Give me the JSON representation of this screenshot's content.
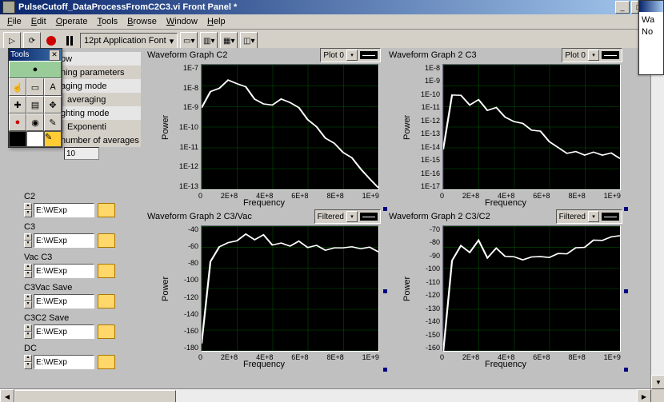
{
  "window": {
    "title": "PulseCutoff_DataProcessFromC2C3.vi Front Panel *"
  },
  "menu": {
    "items": [
      "File",
      "Edit",
      "Operate",
      "Tools",
      "Browse",
      "Window",
      "Help"
    ]
  },
  "toolbar": {
    "font_label": "12pt Application Font"
  },
  "tools_palette": {
    "title": "Tools"
  },
  "settings": {
    "items": [
      "ow",
      "ning parameters",
      "aging mode",
      "averaging",
      "ghting mode",
      "Exponenti",
      "number of averages"
    ],
    "num_avg_value": "10"
  },
  "paths": [
    {
      "label": "C2",
      "value": "E:\\WExp"
    },
    {
      "label": "C3",
      "value": "E:\\WExp"
    },
    {
      "label": "Vac C3",
      "value": "E:\\WExp"
    },
    {
      "label": "C3Vac Save",
      "value": "E:\\WExp"
    },
    {
      "label": "C3C2 Save",
      "value": "E:\\WExp"
    },
    {
      "label": "DC",
      "value": "E:\\WExp"
    }
  ],
  "axes": {
    "xlabel": "Frequency",
    "ylabel": "Power",
    "xticks": [
      "0",
      "2E+8",
      "4E+8",
      "6E+8",
      "8E+8",
      "1E+9"
    ]
  },
  "graphs": [
    {
      "title": "Waveform Graph C2",
      "legend": "Plot 0",
      "yticks": [
        "1E-7",
        "1E-8",
        "1E-9",
        "1E-10",
        "1E-11",
        "1E-12",
        "1E-13"
      ]
    },
    {
      "title": "Waveform Graph 2 C3",
      "legend": "Plot 0",
      "yticks": [
        "1E-8",
        "1E-9",
        "1E-10",
        "1E-11",
        "1E-12",
        "1E-13",
        "1E-14",
        "1E-15",
        "1E-16",
        "1E-17"
      ]
    },
    {
      "title": "Waveform Graph 2 C3/Vac",
      "legend": "Filtered",
      "yticks": [
        "-40",
        "-60",
        "-80",
        "-100",
        "-120",
        "-140",
        "-160",
        "-180"
      ]
    },
    {
      "title": "Waveform Graph 2 C3/C2",
      "legend": "Filtered",
      "yticks": [
        "-70",
        "-80",
        "-90",
        "-100",
        "-110",
        "-120",
        "-130",
        "-140",
        "-150",
        "-160"
      ]
    }
  ],
  "side_window": {
    "lines": [
      "Wa",
      "No"
    ]
  },
  "chart_data": [
    {
      "type": "line",
      "title": "Waveform Graph C2",
      "xlabel": "Frequency",
      "ylabel": "Power",
      "xlim": [
        0,
        1000000000.0
      ],
      "ylim_log10": [
        -13,
        -7
      ],
      "x": [
        0,
        50000000.0,
        100000000.0,
        150000000.0,
        200000000.0,
        250000000.0,
        300000000.0,
        350000000.0,
        400000000.0,
        450000000.0,
        500000000.0,
        550000000.0,
        600000000.0,
        650000000.0,
        700000000.0,
        750000000.0,
        800000000.0,
        850000000.0,
        900000000.0,
        950000000.0,
        1000000000.0
      ],
      "y_log10": [
        -9.0,
        -8.3,
        -8.0,
        -7.8,
        -7.9,
        -8.2,
        -8.6,
        -8.9,
        -8.8,
        -8.7,
        -8.8,
        -9.2,
        -9.6,
        -10.0,
        -10.4,
        -10.8,
        -11.2,
        -11.6,
        -12.0,
        -12.5,
        -12.8
      ]
    },
    {
      "type": "line",
      "title": "Waveform Graph 2 C3",
      "xlabel": "Frequency",
      "ylabel": "Power",
      "xlim": [
        0,
        1000000000.0
      ],
      "ylim_log10": [
        -17,
        -8
      ],
      "x": [
        0,
        50000000.0,
        100000000.0,
        150000000.0,
        200000000.0,
        250000000.0,
        300000000.0,
        350000000.0,
        400000000.0,
        450000000.0,
        500000000.0,
        550000000.0,
        600000000.0,
        650000000.0,
        700000000.0,
        750000000.0,
        800000000.0,
        850000000.0,
        900000000.0,
        950000000.0,
        1000000000.0
      ],
      "y_log10": [
        -14.0,
        -10.2,
        -10.0,
        -11.0,
        -10.5,
        -11.5,
        -11.0,
        -11.8,
        -11.9,
        -12.3,
        -12.7,
        -13.0,
        -13.5,
        -14.0,
        -14.2,
        -14.3,
        -14.5,
        -14.5,
        -14.5,
        -14.4,
        -14.6
      ]
    },
    {
      "type": "line",
      "title": "Waveform Graph 2 C3/Vac",
      "xlabel": "Frequency",
      "ylabel": "Power",
      "xlim": [
        0,
        1000000000.0
      ],
      "ylim": [
        -180,
        -40
      ],
      "x": [
        0,
        50000000.0,
        100000000.0,
        150000000.0,
        200000000.0,
        250000000.0,
        300000000.0,
        350000000.0,
        400000000.0,
        450000000.0,
        500000000.0,
        550000000.0,
        600000000.0,
        650000000.0,
        700000000.0,
        750000000.0,
        800000000.0,
        850000000.0,
        900000000.0,
        950000000.0,
        1000000000.0
      ],
      "y": [
        -170,
        -80,
        -60,
        -60,
        -56,
        -52,
        -54,
        -50,
        -58,
        -60,
        -62,
        -60,
        -63,
        -62,
        -64,
        -65,
        -64,
        -66,
        -65,
        -64,
        -66
      ]
    },
    {
      "type": "line",
      "title": "Waveform Graph 2 C3/C2",
      "xlabel": "Frequency",
      "ylabel": "Power",
      "xlim": [
        0,
        1000000000.0
      ],
      "ylim": [
        -160,
        -70
      ],
      "x": [
        0,
        50000000.0,
        100000000.0,
        150000000.0,
        200000000.0,
        250000000.0,
        300000000.0,
        350000000.0,
        400000000.0,
        450000000.0,
        500000000.0,
        550000000.0,
        600000000.0,
        650000000.0,
        700000000.0,
        750000000.0,
        800000000.0,
        850000000.0,
        900000000.0,
        950000000.0,
        1000000000.0
      ],
      "y": [
        -160,
        -95,
        -82,
        -90,
        -80,
        -95,
        -85,
        -92,
        -90,
        -95,
        -92,
        -94,
        -92,
        -90,
        -88,
        -86,
        -85,
        -82,
        -80,
        -78,
        -75
      ]
    }
  ]
}
